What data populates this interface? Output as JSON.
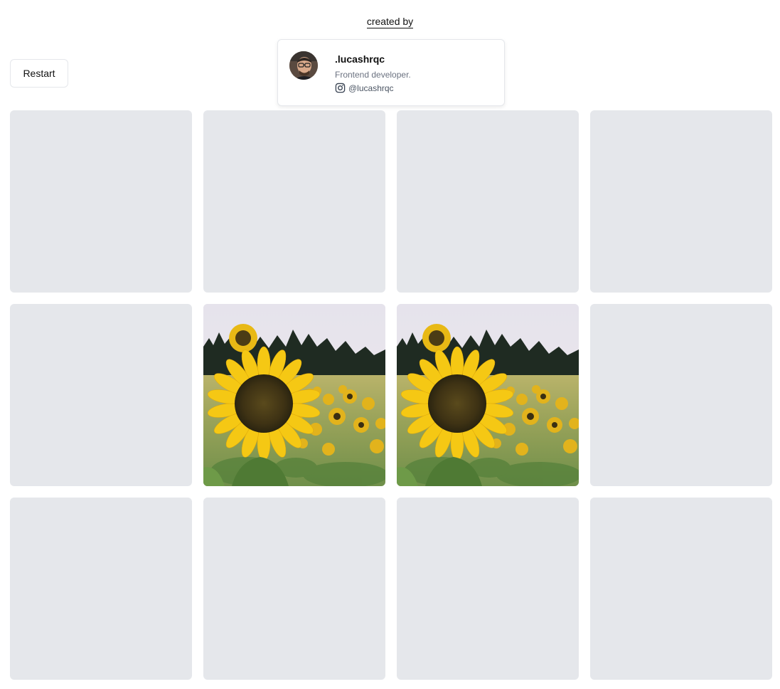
{
  "header": {
    "created_by_label": "created by"
  },
  "controls": {
    "restart_label": "Restart"
  },
  "profile": {
    "name": ".lucashrqc",
    "bio": "Frontend developer.",
    "instagram_handle": "@lucashrqc",
    "avatar_icon": "avatar-photo",
    "social_icon": "instagram-icon"
  },
  "board": {
    "card_back_color": "#e5e7eb",
    "cards": [
      {
        "flipped": false,
        "image": ""
      },
      {
        "flipped": false,
        "image": ""
      },
      {
        "flipped": false,
        "image": ""
      },
      {
        "flipped": false,
        "image": ""
      },
      {
        "flipped": false,
        "image": ""
      },
      {
        "flipped": true,
        "image": "sunflower-field"
      },
      {
        "flipped": true,
        "image": "sunflower-field"
      },
      {
        "flipped": false,
        "image": ""
      },
      {
        "flipped": false,
        "image": ""
      },
      {
        "flipped": false,
        "image": ""
      },
      {
        "flipped": false,
        "image": ""
      },
      {
        "flipped": false,
        "image": ""
      }
    ]
  }
}
